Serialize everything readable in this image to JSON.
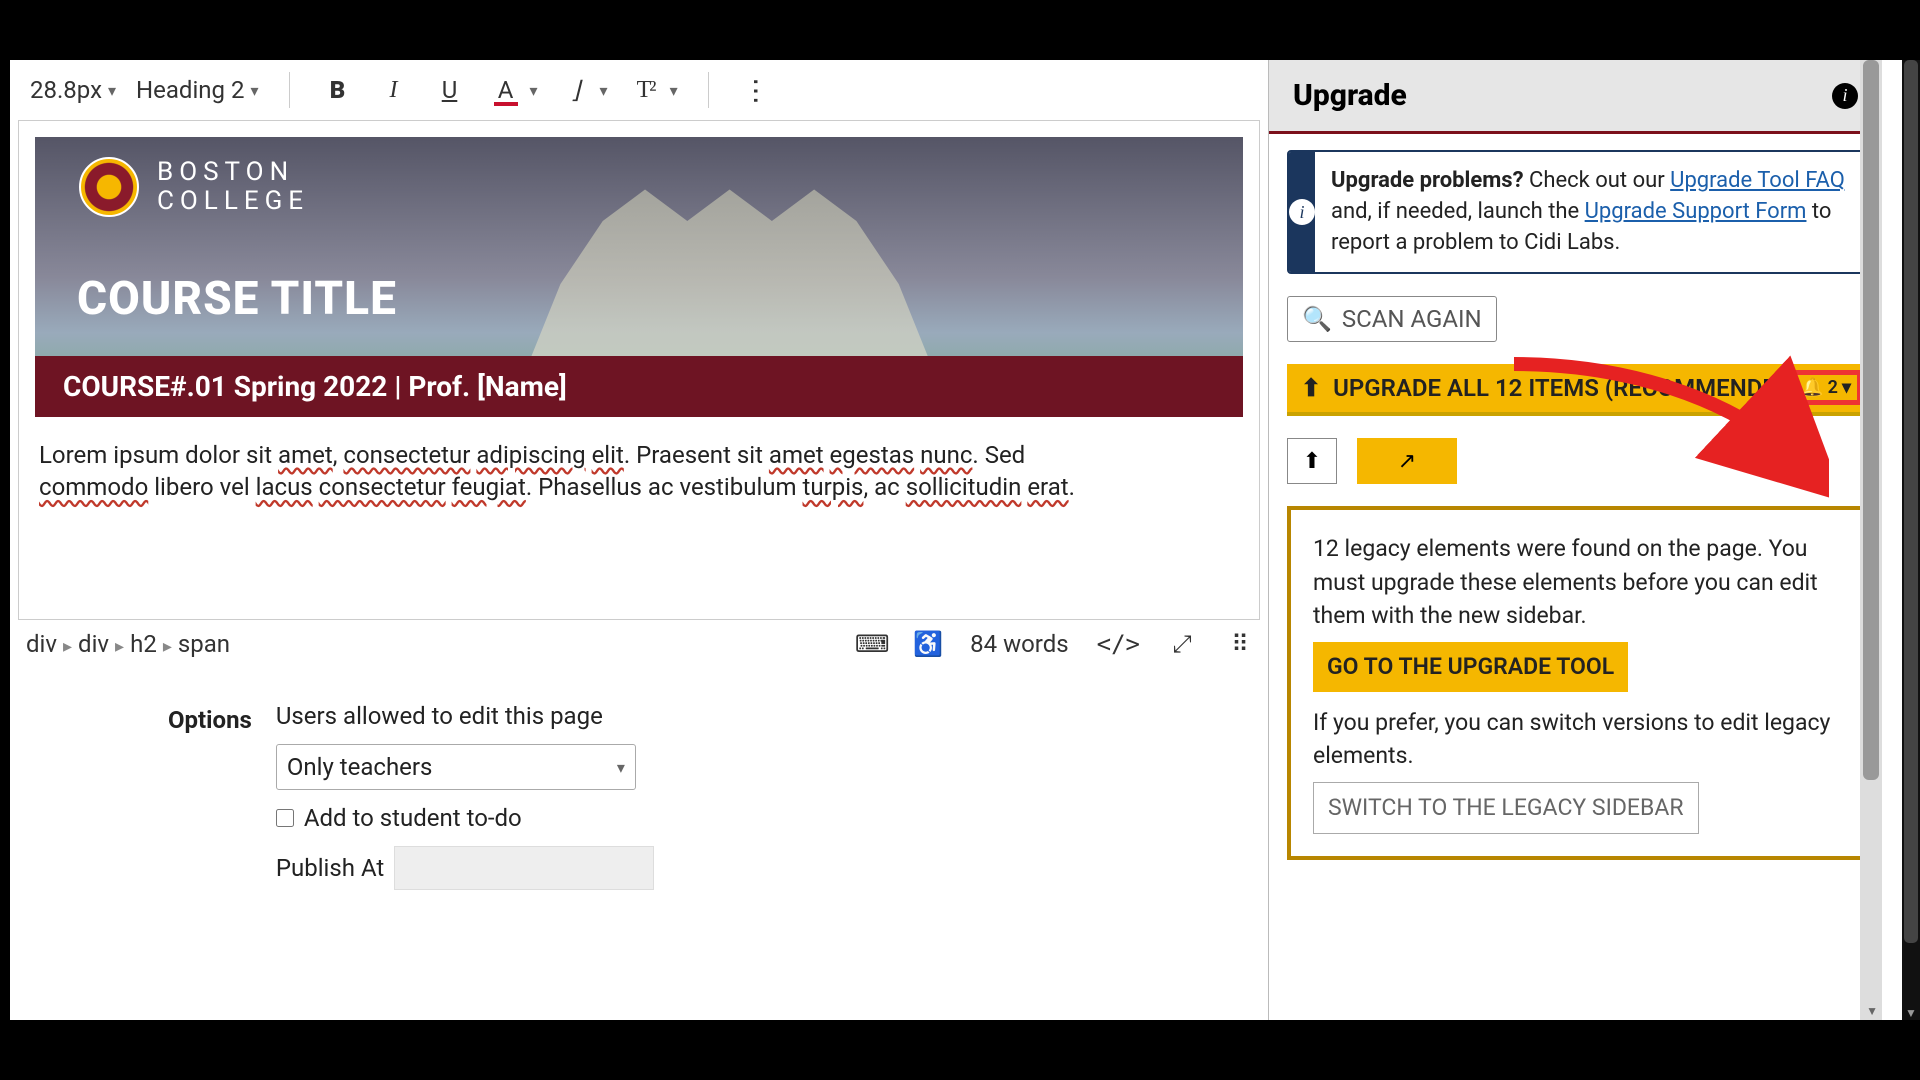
{
  "toolbar": {
    "font_size": "28.8px",
    "block_format": "Heading 2"
  },
  "banner": {
    "brand_line1": "BOSTON",
    "brand_line2": "COLLEGE",
    "title": "COURSE TITLE",
    "subtitle": "COURSE#.01 Spring 2022 | Prof. [Name]"
  },
  "body_text": {
    "p1_a": "Lorem ipsum dolor sit ",
    "p1_w1": "amet",
    "p1_b": ", ",
    "p1_w2": "consectetur",
    "p1_c": " ",
    "p1_w3": "adipiscing",
    "p1_d": " ",
    "p1_w4": "elit",
    "p1_e": ". Praesent sit ",
    "p1_w5": "amet",
    "p1_f": " ",
    "p1_w6": "egestas",
    "p1_g": " ",
    "p1_w7": "nunc",
    "p1_h": ". Sed ",
    "p2_a": "commodo",
    "p2_b": " libero vel ",
    "p2_c": "lacus",
    "p2_d": " ",
    "p2_e": "consectetur",
    "p2_f": " ",
    "p2_g": "feugiat",
    "p2_h": ". Phasellus ac vestibulum ",
    "p2_i": "turpis",
    "p2_j": ", ac ",
    "p2_k": "sollicitudin",
    "p2_l": " ",
    "p2_m": "erat",
    "p2_n": "."
  },
  "status": {
    "crumbs": [
      "div",
      "div",
      "h2",
      "span"
    ],
    "words": "84 words",
    "code": "</>"
  },
  "options": {
    "label": "Options",
    "edit_label": "Users allowed to edit this page",
    "select_value": "Only teachers",
    "todo_label": "Add to student to-do",
    "publish_label": "Publish At"
  },
  "sidebar": {
    "title": "Upgrade",
    "alert_lead": "Upgrade problems?",
    "alert_a": " Check out our ",
    "link_faq": "Upgrade Tool FAQ",
    "alert_b": " and, if needed, launch the ",
    "link_form": "Upgrade Support Form",
    "alert_c": " to report a problem to Cidi Labs.",
    "scan": "SCAN AGAIN",
    "upgrade_all": "UPGRADE ALL 12 ITEMS (RECOMMENDED)",
    "notif_count": "2",
    "warn_p1": "12 legacy elements were found on the page. You must upgrade these elements before you can edit them with the new sidebar.",
    "go_btn": "GO TO THE UPGRADE TOOL",
    "warn_p2": "If you prefer, you can switch versions to edit legacy elements.",
    "switch_btn": "SWITCH TO THE LEGACY SIDEBAR"
  }
}
